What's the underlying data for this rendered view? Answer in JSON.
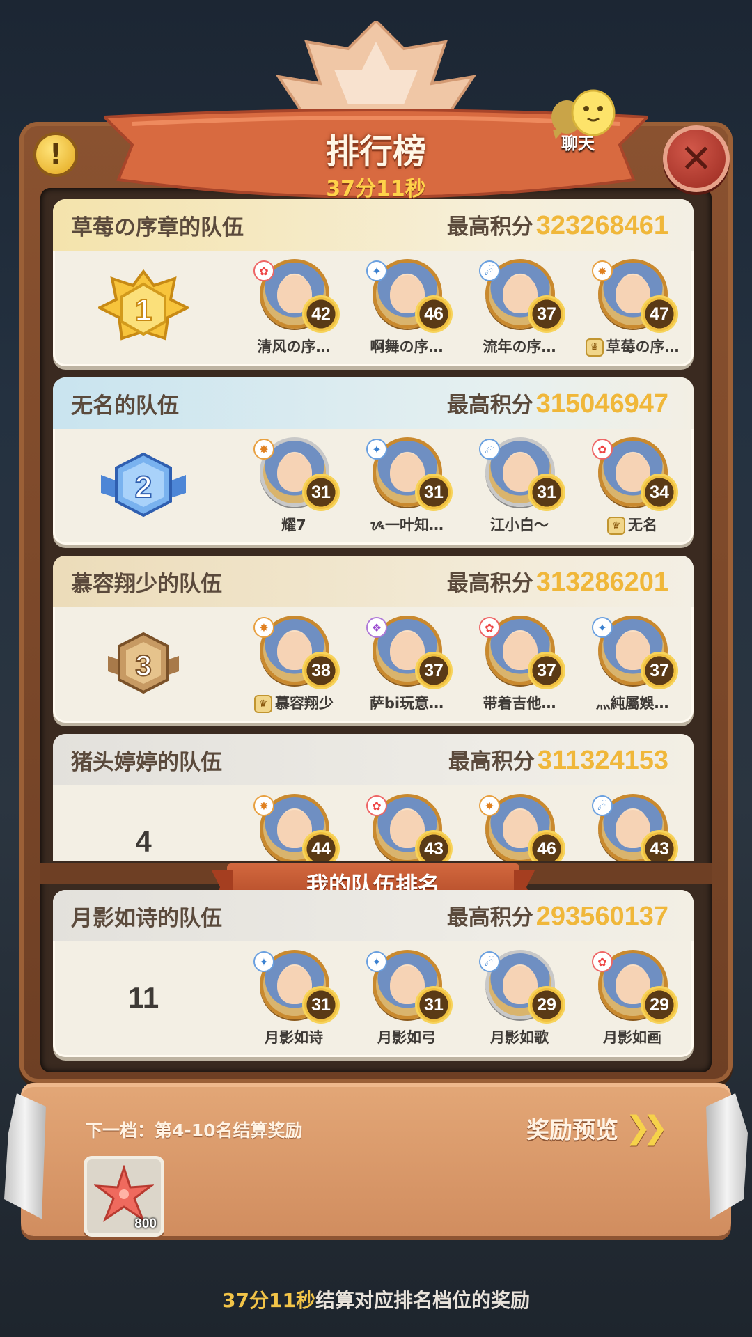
{
  "header": {
    "title": "排行榜",
    "timer": "37分11秒",
    "chat_label": "聊天"
  },
  "teams": [
    {
      "rank": "1",
      "name": "草莓の序章的队伍",
      "score_label": "最高积分",
      "score": "323268461",
      "members": [
        {
          "name": "清风の序…",
          "level": "42"
        },
        {
          "name": "啊舞の序…",
          "level": "46"
        },
        {
          "name": "流年の序…",
          "level": "37"
        },
        {
          "name": "草莓の序…",
          "level": "47",
          "captain": true
        }
      ]
    },
    {
      "rank": "2",
      "name": "无名的队伍",
      "score_label": "最高积分",
      "score": "315046947",
      "members": [
        {
          "name": "耀7",
          "level": "31"
        },
        {
          "name": "ᝰ一叶知…",
          "level": "31"
        },
        {
          "name": "江小白～",
          "level": "31"
        },
        {
          "name": "无名",
          "level": "34",
          "captain": true
        }
      ]
    },
    {
      "rank": "3",
      "name": "慕容翔少的队伍",
      "score_label": "最高积分",
      "score": "313286201",
      "members": [
        {
          "name": "慕容翔少",
          "level": "38",
          "captain": true
        },
        {
          "name": "萨bi玩意…",
          "level": "37"
        },
        {
          "name": "带着吉他…",
          "level": "37"
        },
        {
          "name": "灬純屬娛…",
          "level": "37"
        }
      ]
    },
    {
      "rank": "4",
      "name": "猪头婷婷的队伍",
      "score_label": "最高积分",
      "score": "311324153",
      "members": [
        {
          "name": "",
          "level": "44"
        },
        {
          "name": "",
          "level": "43"
        },
        {
          "name": "",
          "level": "46"
        },
        {
          "name": "",
          "level": "43"
        }
      ]
    }
  ],
  "my_team": {
    "section_label": "我的队伍排名",
    "rank": "11",
    "name": "月影如诗的队伍",
    "score_label": "最高积分",
    "score": "293560137",
    "members": [
      {
        "name": "月影如诗",
        "level": "31"
      },
      {
        "name": "月影如弓",
        "level": "31"
      },
      {
        "name": "月影如歌",
        "level": "29"
      },
      {
        "name": "月影如画",
        "level": "29"
      }
    ]
  },
  "reward": {
    "next_tier": "下一档：第4-10名结算奖励",
    "preview_label": "奖励预览",
    "item_icon": "starfish-icon",
    "item_count": "800"
  },
  "footer": {
    "time": "37分11秒",
    "text": "结算对应排名档位的奖励"
  },
  "colors": {
    "score": "#f0b73a",
    "timer": "#ffd24a",
    "banner": "#d86a40",
    "close_button": "#b8372b"
  }
}
